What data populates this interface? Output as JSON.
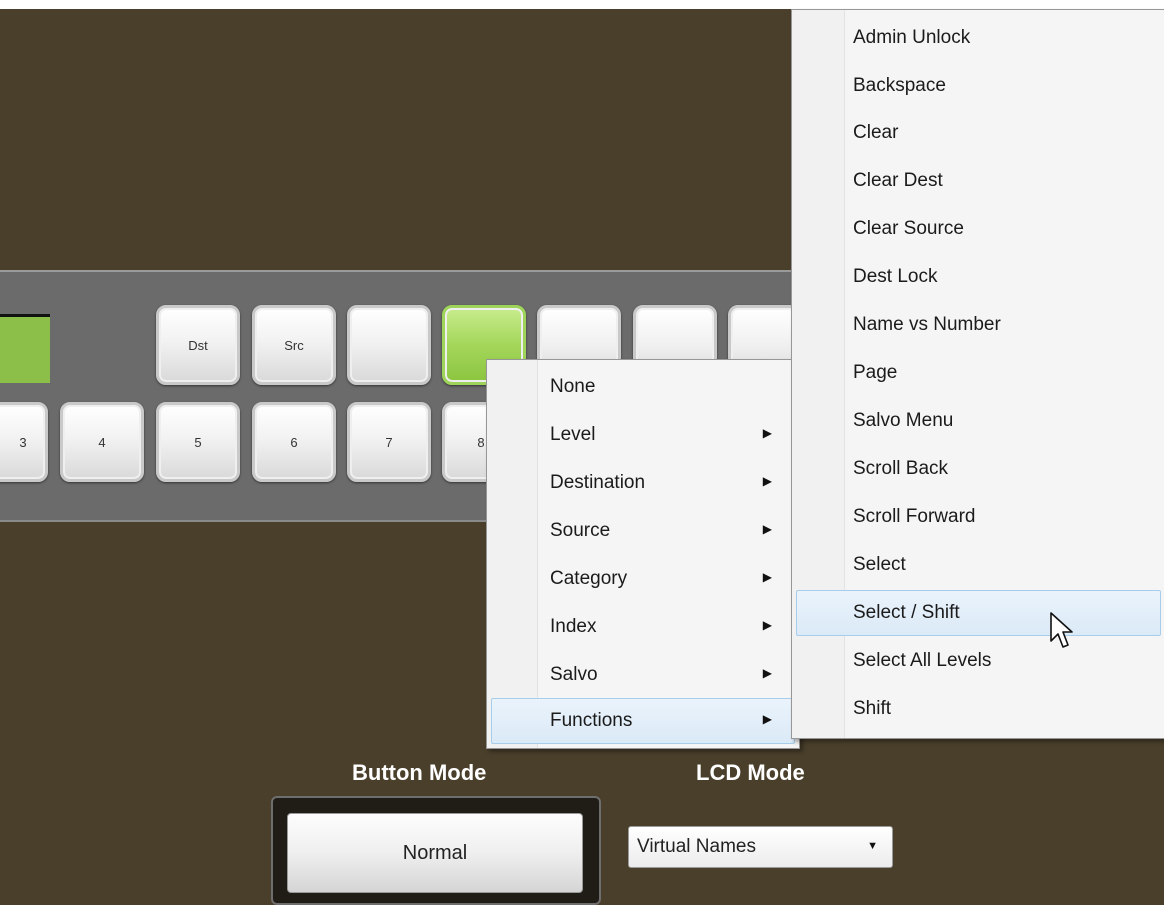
{
  "panel": {
    "top_row": [
      "Dst",
      "Src",
      "",
      "",
      "",
      "",
      ""
    ],
    "bottom_row": [
      "3",
      "4",
      "5",
      "6",
      "7",
      "8"
    ]
  },
  "context_menu": {
    "items": [
      {
        "label": "None",
        "has_submenu": false
      },
      {
        "label": "Level",
        "has_submenu": true
      },
      {
        "label": "Destination",
        "has_submenu": true
      },
      {
        "label": "Source",
        "has_submenu": true
      },
      {
        "label": "Category",
        "has_submenu": true
      },
      {
        "label": "Index",
        "has_submenu": true
      },
      {
        "label": "Salvo",
        "has_submenu": true
      },
      {
        "label": "Functions",
        "has_submenu": true,
        "highlighted": true
      }
    ]
  },
  "functions_submenu": {
    "items": [
      {
        "label": "Admin Unlock"
      },
      {
        "label": "Backspace"
      },
      {
        "label": "Clear"
      },
      {
        "label": "Clear Dest"
      },
      {
        "label": "Clear Source"
      },
      {
        "label": "Dest Lock"
      },
      {
        "label": "Name vs Number"
      },
      {
        "label": "Page"
      },
      {
        "label": "Salvo Menu"
      },
      {
        "label": "Scroll Back"
      },
      {
        "label": "Scroll Forward"
      },
      {
        "label": "Select"
      },
      {
        "label": "Select / Shift",
        "highlighted": true
      },
      {
        "label": "Select All Levels"
      },
      {
        "label": "Shift"
      }
    ]
  },
  "button_mode": {
    "label": "Button Mode",
    "value": "Normal"
  },
  "lcd_mode": {
    "label": "LCD Mode",
    "selected": "Virtual Names"
  },
  "colors": {
    "background": "#4a3f2b",
    "panel": "#6b6b6b",
    "active_key": "#a4d65a",
    "menu_highlight": "#dbeaf7"
  }
}
